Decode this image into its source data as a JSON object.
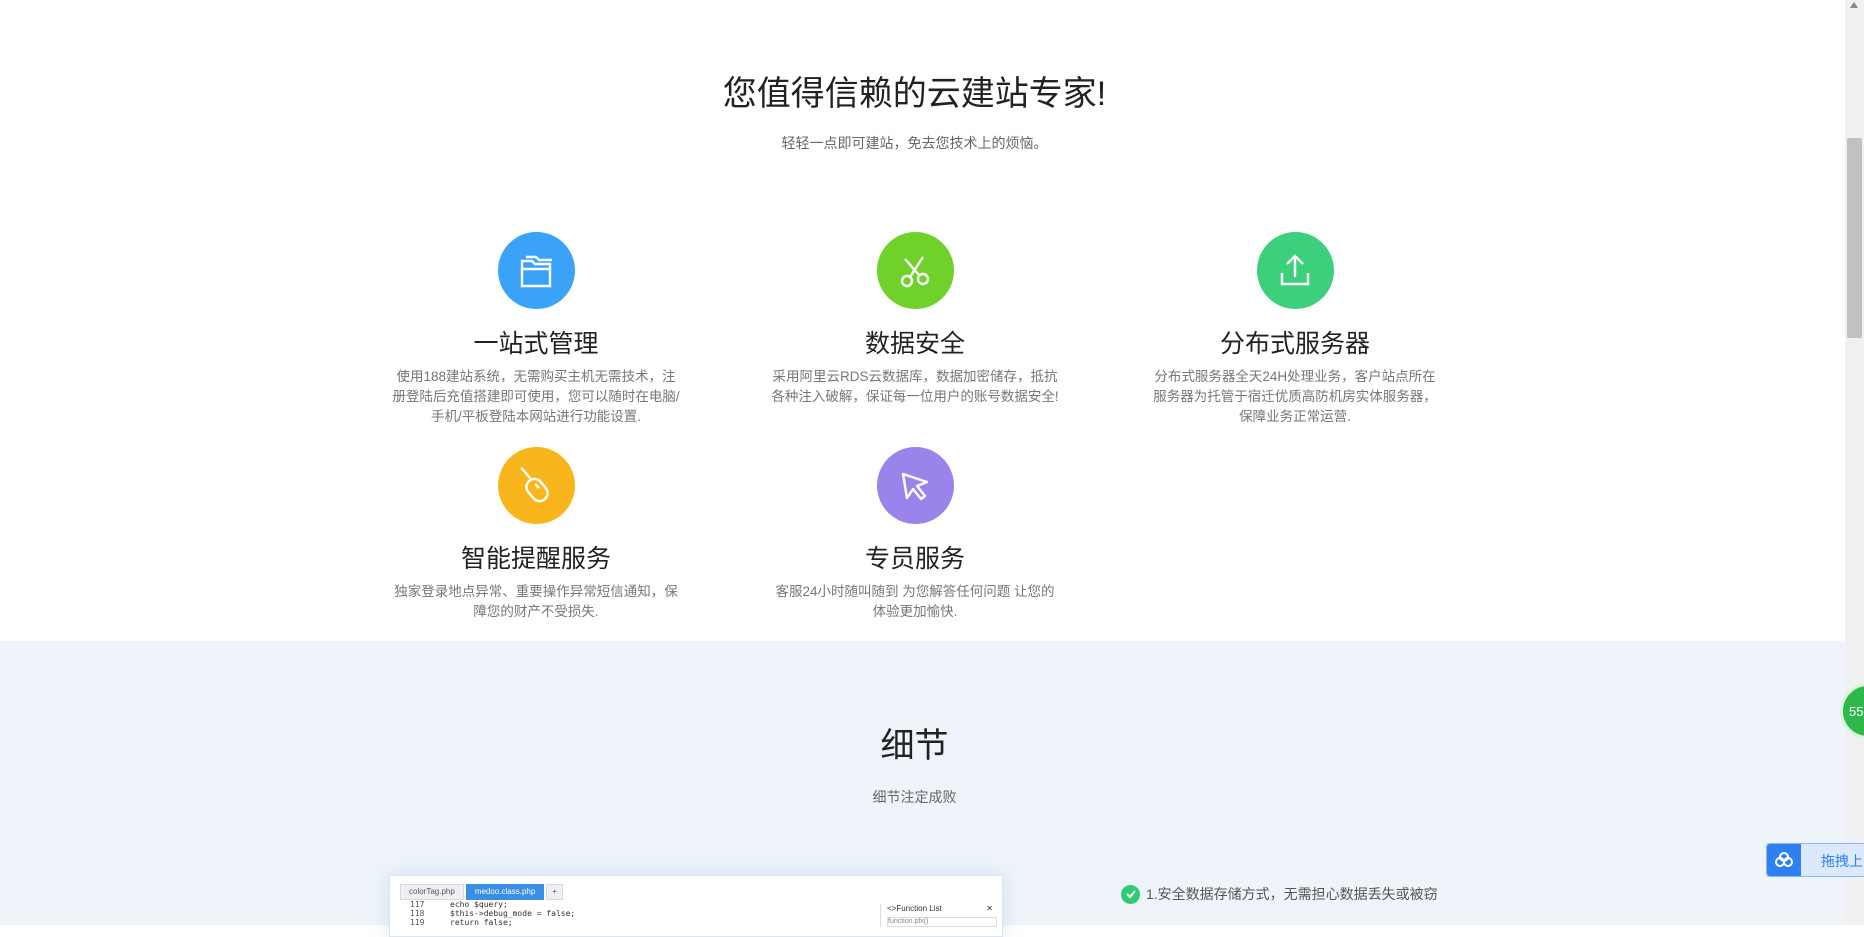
{
  "hero": {
    "title": "您值得信赖的云建站专家!",
    "subtitle": "轻轻一点即可建站，免去您技术上的烦恼。"
  },
  "features": [
    {
      "icon": "folder-icon",
      "color": "#3aa3f7",
      "title": "一站式管理",
      "desc": "使用188建站系统，无需购买主机无需技术，注册登陆后充值搭建即可使用，您可以随时在电脑/手机/平板登陆本网站进行功能设置."
    },
    {
      "icon": "scissors-icon",
      "color": "#6fd12a",
      "title": "数据安全",
      "desc": "采用阿里云RDS云数据库，数据加密储存，抵抗各种注入破解，保证每一位用户的账号数据安全!"
    },
    {
      "icon": "upload-icon",
      "color": "#3dd07c",
      "title": "分布式服务器",
      "desc": "分布式服务器全天24H处理业务，客户站点所在服务器为托管于宿迁优质高防机房实体服务器，保障业务正常运营."
    },
    {
      "icon": "mouse-icon",
      "color": "#f9b51c",
      "title": "智能提醒服务",
      "desc": "独家登录地点异常、重要操作异常短信通知，保障您的财产不受损失."
    },
    {
      "icon": "cursor-icon",
      "color": "#9a83ea",
      "title": "专员服务",
      "desc": "客服24小时随叫随到 为您解答任何问题 让您的体验更加愉快."
    }
  ],
  "details": {
    "title": "细节",
    "subtitle": "细节注定成败",
    "item1": "1.安全数据存储方式，无需担心数据丢失或被窃"
  },
  "editor": {
    "tabs": [
      "colorTag.php",
      "medoo.class.php",
      "+"
    ],
    "lines": [
      {
        "n": "117",
        "code": "echo $query;"
      },
      {
        "n": "118",
        "code": "$this->debug_mode = false;"
      },
      {
        "n": "119",
        "code": "return false;"
      }
    ],
    "panel_title": "<>Function List",
    "panel_close": "✕",
    "panel_filter": "function.pfx()"
  },
  "floating": {
    "badge": "55",
    "drag_label": "拖拽上"
  },
  "colors": {
    "section_alt_bg": "#eef4fa",
    "check_green": "#2ecc71",
    "accent_blue": "#2e7ff0"
  }
}
